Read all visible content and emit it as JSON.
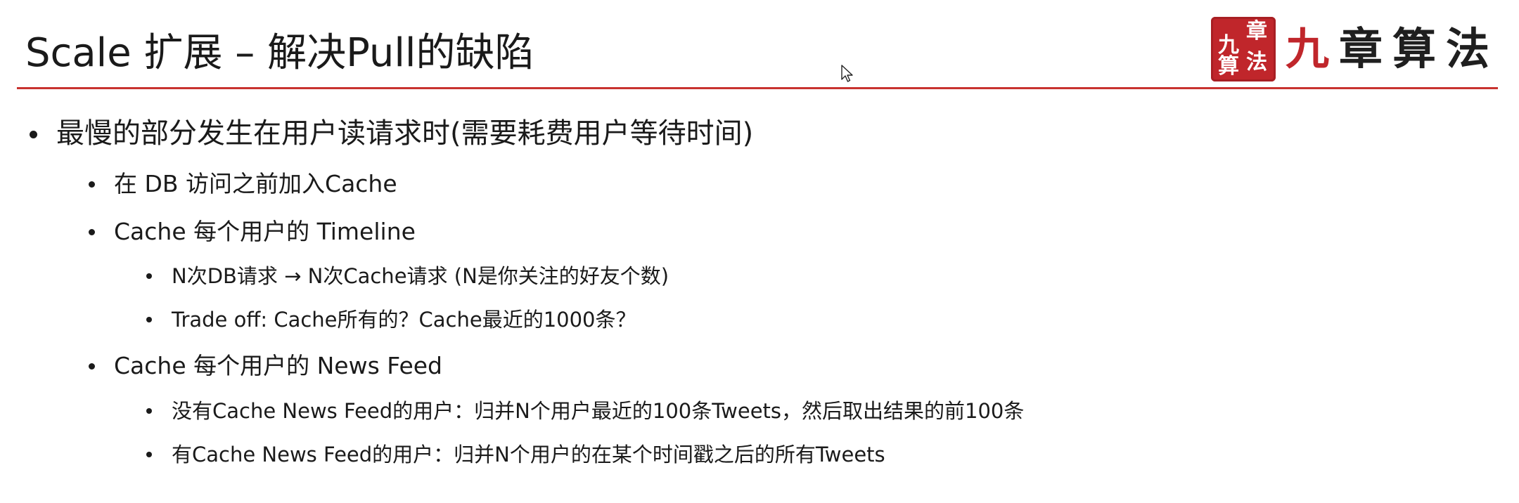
{
  "slide": {
    "title": "Scale 扩展 – 解决Pull的缺陷",
    "logo": {
      "seal_chars": [
        "九",
        "章",
        "算",
        "法"
      ],
      "text_first": "九",
      "text_rest": "章算法"
    },
    "colors": {
      "accent": "#c8332f",
      "seal": "#c0262b",
      "text": "#1a1a1a"
    },
    "bullets": {
      "b1": "最慢的部分发生在用户读请求时(需要耗费用户等待时间)",
      "b1_1": "在 DB 访问之前加入Cache",
      "b1_2": "Cache 每个用户的 Timeline",
      "b1_2_1": "N次DB请求 → N次Cache请求 (N是你关注的好友个数)",
      "b1_2_2": "Trade off: Cache所有的？Cache最近的1000条？",
      "b1_3": "Cache 每个用户的 News Feed",
      "b1_3_1": "没有Cache News Feed的用户：归并N个用户最近的100条Tweets，然后取出结果的前100条",
      "b1_3_2": "有Cache News Feed的用户：归并N个用户的在某个时间戳之后的所有Tweets"
    }
  }
}
